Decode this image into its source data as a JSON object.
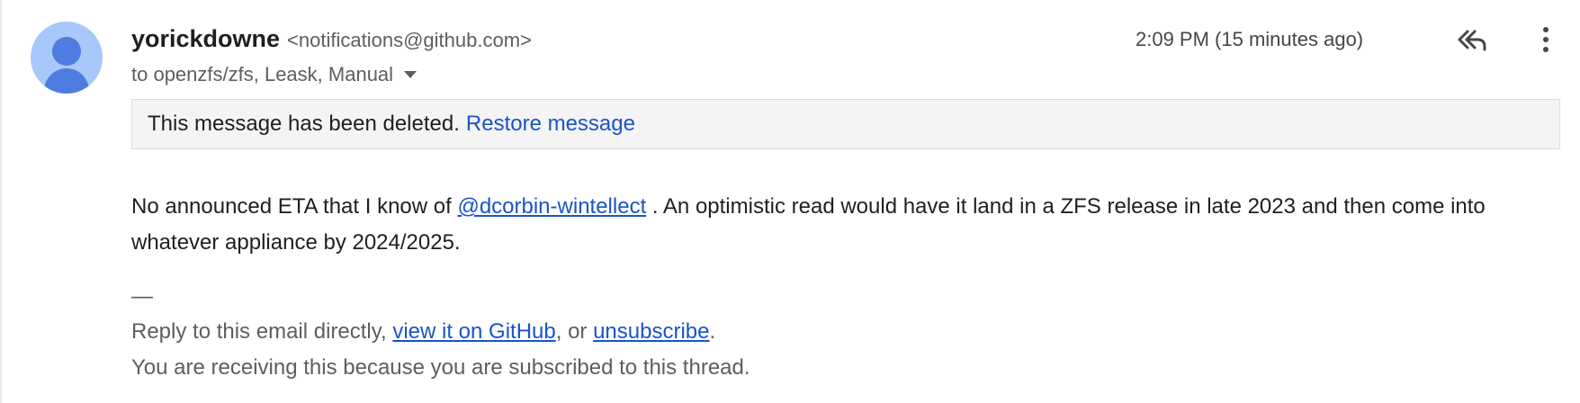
{
  "header": {
    "sender_name": "yorickdowne",
    "sender_email": "<notifications@github.com>",
    "recipients": "to openzfs/zfs, Leask, Manual",
    "timestamp": "2:09 PM (15 minutes ago)"
  },
  "icons": {
    "avatar": "default-person-avatar-icon",
    "recipients_toggle": "chevron-down-icon",
    "reply_all": "reply-all-icon",
    "more": "more-vertical-icon"
  },
  "banner": {
    "text": "This message has been deleted.",
    "restore_label": "Restore message"
  },
  "body": {
    "line_start": "No announced ETA that I know of ",
    "mention": "@dcorbin-wintellect",
    "line_rest": " . An optimistic read would have it land in a ZFS release in late 2023 and then come into whatever appliance by 2024/2025."
  },
  "footer": {
    "dash": "—",
    "reply_prefix": "Reply to this email directly, ",
    "view_link": "view it on GitHub",
    "or_text": ", or ",
    "unsubscribe_link": "unsubscribe",
    "period": ".",
    "subscription_note": "You are receiving this because you are subscribed to this thread."
  },
  "colors": {
    "link": "#1a54c9",
    "avatar_bg": "#a8c7fa",
    "avatar_fg": "#4f7ce0",
    "banner_bg": "#f4f4f4",
    "secondary_text": "#5e5e5e"
  }
}
